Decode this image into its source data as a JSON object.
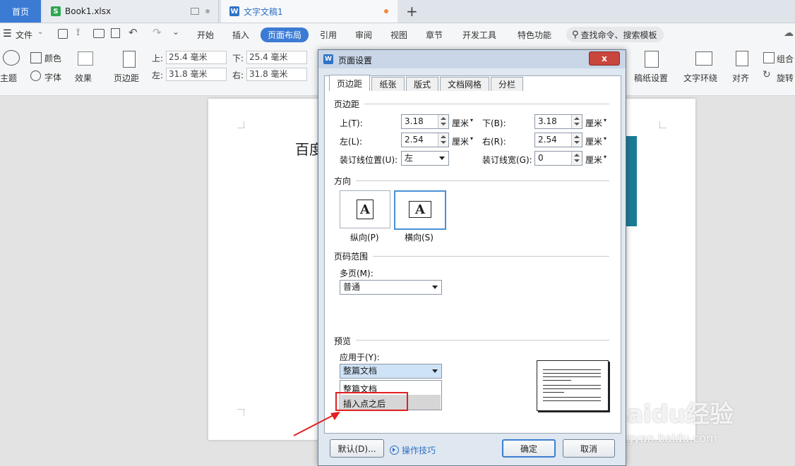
{
  "tabs": {
    "home": "首页",
    "book": "Book1.xlsx",
    "doc": "文字文稿1",
    "add": "+"
  },
  "menu": {
    "file": "文件",
    "items": [
      "开始",
      "插入",
      "页面布局",
      "引用",
      "审阅",
      "视图",
      "章节",
      "开发工具",
      "特色功能"
    ],
    "search": "查找命令、搜索模板"
  },
  "ribbon": {
    "theme": "主题",
    "color": "颜色",
    "font": "字体",
    "effect": "效果",
    "margin": "页边距",
    "top_label": "上:",
    "top_value": "25.4 毫米",
    "bottom_label": "下:",
    "bottom_value": "25.4 毫米",
    "left_label": "左:",
    "left_value": "31.8 毫米",
    "right_label": "右:",
    "right_value": "31.8 毫米",
    "draft": "稿纸设置",
    "wrap": "文字环绕",
    "align": "对齐",
    "group": "组合",
    "rotate": "旋转"
  },
  "document": {
    "text": "百度"
  },
  "dialog": {
    "title": "页面设置",
    "close": "x",
    "tabs": [
      "页边距",
      "纸张",
      "版式",
      "文档网格",
      "分栏"
    ],
    "margins_section": "页边距",
    "top_label": "上(T):",
    "top_value": "3.18",
    "bottom_label": "下(B):",
    "bottom_value": "3.18",
    "left_label": "左(L):",
    "left_value": "2.54",
    "right_label": "右(R):",
    "right_value": "2.54",
    "unit": "厘米",
    "gutter_pos_label": "装订线位置(U):",
    "gutter_pos_value": "左",
    "gutter_width_label": "装订线宽(G):",
    "gutter_width_value": "0",
    "orientation_section": "方向",
    "portrait": "纵向(P)",
    "landscape": "横向(S)",
    "page_range_section": "页码范围",
    "multi_page_label": "多页(M):",
    "multi_page_value": "普通",
    "preview_section": "预览",
    "apply_label": "应用于(Y):",
    "apply_value": "整篇文档",
    "apply_options": [
      "整篇文档",
      "插入点之后"
    ],
    "default_button": "默认(D)...",
    "tips": "操作技巧",
    "ok_button": "确定",
    "cancel_button": "取消"
  },
  "watermark": {
    "main": "Baidu经验",
    "sub": "jingyan.baidu.com"
  },
  "colors": {
    "accent": "#3b7bd4",
    "highlight": "#e02020"
  }
}
